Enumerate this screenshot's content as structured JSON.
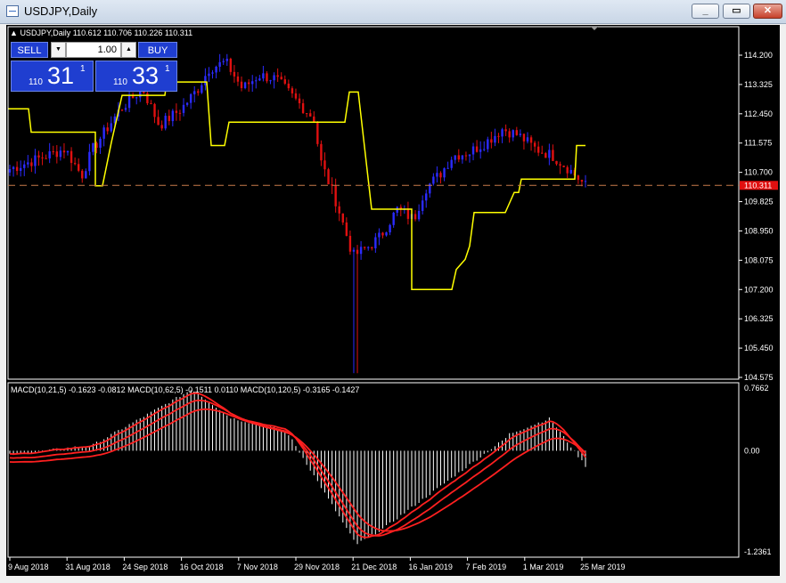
{
  "window": {
    "title": "USDJPY,Daily"
  },
  "legend": {
    "text": "USDJPY,Daily 110.612 110.706 110.226 110.311"
  },
  "trade_panel": {
    "sell_label": "SELL",
    "buy_label": "BUY",
    "volume": "1.00",
    "bid_prefix": "110",
    "bid_big": "31",
    "bid_sup": "1",
    "ask_prefix": "110",
    "ask_big": "33",
    "ask_sup": "1"
  },
  "price_axis": {
    "labels": [
      "114.200",
      "113.325",
      "112.450",
      "111.575",
      "110.700",
      "109.825",
      "108.950",
      "108.075",
      "107.200",
      "106.325",
      "105.450",
      "104.575"
    ],
    "current_price": "110.311"
  },
  "macd": {
    "legend": "MACD(10,21,5) -0.1623 -0.0812  MACD(10,62,5) -0.1511 0.0110  MACD(10,120,5) -0.3165 -0.1427",
    "labels": [
      "0.7662",
      "0.00",
      "-1.2361"
    ]
  },
  "time_axis": {
    "labels": [
      "9 Aug 2018",
      "31 Aug 2018",
      "24 Sep 2018",
      "16 Oct 2018",
      "7 Nov 2018",
      "29 Nov 2018",
      "21 Dec 2018",
      "16 Jan 2019",
      "7 Feb 2019",
      "1 Mar 2019",
      "25 Mar 2019"
    ]
  },
  "colors": {
    "background": "#000000",
    "bull_candle": "#2b2bff",
    "bear_candle": "#e01010",
    "channel_line": "#ffff00",
    "price_line": "#c87b4a",
    "macd_line": "#ff2020",
    "histogram": "#ffffff"
  }
}
